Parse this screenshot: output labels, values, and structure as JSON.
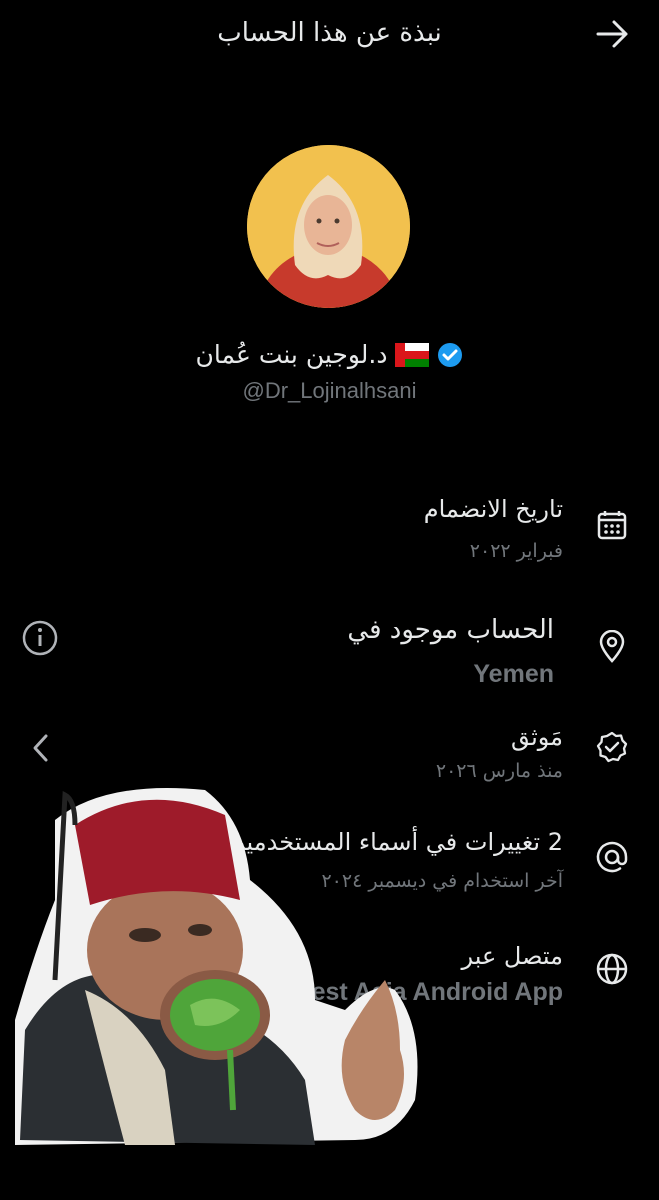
{
  "header": {
    "title": "نبذة عن هذا الحساب"
  },
  "profile": {
    "display_name": "د.لوجين بنت عُمان",
    "handle": "@Dr_Lojinalhsani"
  },
  "rows": [
    {
      "title": "تاريخ الانضمام",
      "subtitle": "فبراير ٢٠٢٢",
      "icon": "calendar-icon"
    },
    {
      "title": "الحساب موجود في",
      "subtitle": "Yemen",
      "icon": "location-pin-icon",
      "side_icon": "info-icon"
    },
    {
      "title": "مَوثق",
      "subtitle": "منذ مارس ٢٠٢٦",
      "icon": "verified-badge-icon",
      "side_icon": "chevron-left-icon"
    },
    {
      "title": "2 تغييرات في أسماء المستخدمين",
      "subtitle": "آخر استخدام في ديسمبر ٢٠٢٤",
      "icon": "at-sign-icon"
    },
    {
      "title": "متصل عبر",
      "subtitle": "West Asia Android App",
      "icon": "globe-icon"
    }
  ],
  "colors": {
    "background": "#000000",
    "text": "#e7e9ea",
    "muted": "#71767b",
    "verified": "#1d9bf0",
    "avatar_bg": "#f2c14e"
  }
}
